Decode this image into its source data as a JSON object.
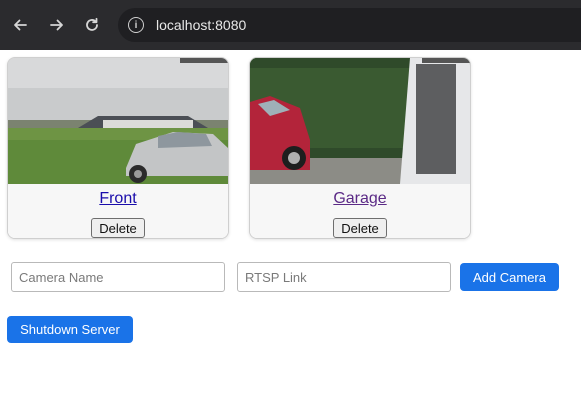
{
  "browser": {
    "url": "localhost:8080",
    "back_icon": "back-arrow-icon",
    "forward_icon": "forward-arrow-icon",
    "reload_icon": "reload-icon",
    "info_icon": "info-icon",
    "info_glyph": "i"
  },
  "cameras": [
    {
      "name": "Front",
      "delete_label": "Delete"
    },
    {
      "name": "Garage",
      "delete_label": "Delete"
    }
  ],
  "form": {
    "name_placeholder": "Camera Name",
    "name_value": "",
    "link_placeholder": "RTSP Link",
    "link_value": "",
    "add_label": "Add Camera"
  },
  "shutdown_label": "Shutdown Server",
  "colors": {
    "accent": "#1a73e8",
    "link": "#1a0dab",
    "visited_link": "#5b2a86",
    "chrome": "#2b2b2e"
  }
}
